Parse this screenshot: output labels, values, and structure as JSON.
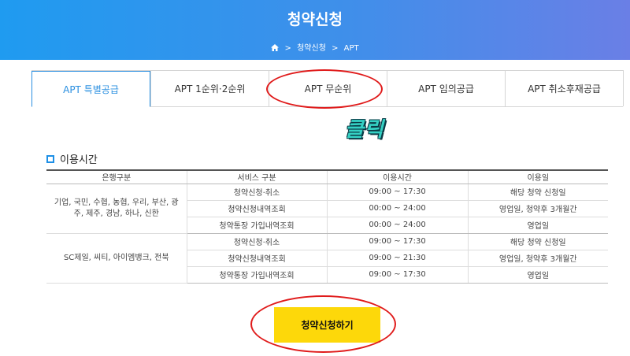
{
  "header": {
    "title": "청약신청",
    "breadcrumb": [
      "청약신청",
      "APT"
    ]
  },
  "tabs": [
    {
      "label": "APT 특별공급",
      "active": true
    },
    {
      "label": "APT 1순위·2순위",
      "active": false
    },
    {
      "label": "APT 무순위",
      "active": false
    },
    {
      "label": "APT 임의공급",
      "active": false
    },
    {
      "label": "APT 취소후재공급",
      "active": false
    }
  ],
  "annotation": {
    "click_text": "클릭",
    "color": "#e01b1b"
  },
  "section": {
    "title": "이용시간"
  },
  "table": {
    "headers": [
      "은행구분",
      "서비스 구분",
      "이용시간",
      "이용일"
    ],
    "groups": [
      {
        "banks": "기업, 국민, 수협, 농협, 우리, 부산, 광주, 제주, 경남, 하나, 신한",
        "rows": [
          {
            "service": "청약신청·취소",
            "time": "09:00 ~ 17:30",
            "days": "해당 청약 신청일"
          },
          {
            "service": "청약신청내역조회",
            "time": "00:00 ~ 24:00",
            "days": "영업일, 청약후 3개월간"
          },
          {
            "service": "청약통장 가입내역조회",
            "time": "00:00 ~ 24:00",
            "days": "영업일"
          }
        ]
      },
      {
        "banks": "SC제일, 씨티, 아이엠뱅크, 전북",
        "rows": [
          {
            "service": "청약신청·취소",
            "time": "09:00 ~ 17:30",
            "days": "해당 청약 신청일"
          },
          {
            "service": "청약신청내역조회",
            "time": "09:00 ~ 21:30",
            "days": "영업일, 청약후 3개월간"
          },
          {
            "service": "청약통장 가입내역조회",
            "time": "09:00 ~ 17:30",
            "days": "영업일"
          }
        ]
      }
    ]
  },
  "apply_button": {
    "label": "청약신청하기"
  },
  "colors": {
    "accent": "#2a8fe0",
    "button": "#fdd80a"
  }
}
